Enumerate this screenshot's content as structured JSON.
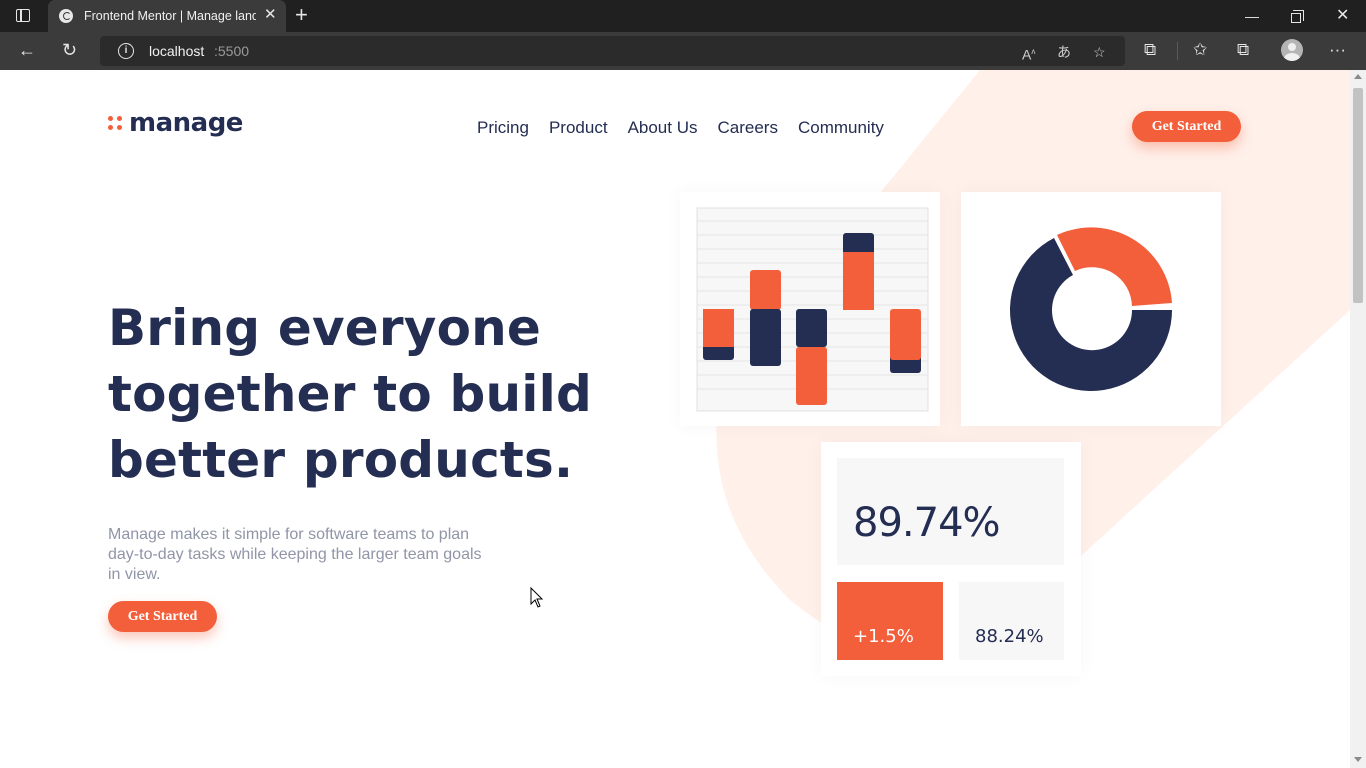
{
  "browser": {
    "tab_title": "Frontend Mentor | Manage landi",
    "url_host": "localhost",
    "url_port": ":5500"
  },
  "header": {
    "logo_text": "manage",
    "nav": [
      "Pricing",
      "Product",
      "About Us",
      "Careers",
      "Community"
    ],
    "cta_label": "Get Started"
  },
  "hero": {
    "title_lines": [
      "Bring everyone",
      "together to build",
      "better products."
    ],
    "description": "Manage makes it simple for software teams to plan day-to-day tasks while keeping the larger team goals in view.",
    "cta_label": "Get Started"
  },
  "stats": {
    "main": "89.74%",
    "change": "+1.5%",
    "secondary": "88.24%"
  },
  "colors": {
    "accent": "#f25f3a",
    "navy": "#242d52",
    "peach": "#fff0ea"
  }
}
